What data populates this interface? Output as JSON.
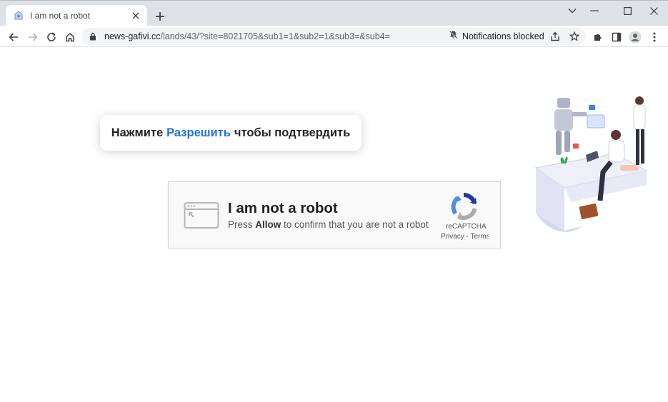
{
  "tab": {
    "title": "I am not a robot"
  },
  "address_bar": {
    "host": "news-gafivi.cc",
    "path": "/lands/43/?site=8021705&sub1=1&sub2=1&sub3=&sub4=",
    "notification_status": "Notifications blocked"
  },
  "bubble": {
    "prefix": "Нажмите",
    "highlight": "Разрешить",
    "suffix": "чтобы подтвердить"
  },
  "captcha": {
    "title": "I am not a robot",
    "sub_prefix": "Press",
    "sub_bold": "Allow",
    "sub_suffix": "to confirm that you are not a robot",
    "brand": "reCAPTCHA",
    "links": "Privacy - Terms"
  },
  "colors": {
    "accent": "#1a73e8",
    "titlebar": "#dee1e6",
    "omnibox": "#f1f3f4"
  },
  "icons": [
    "tab-favicon-icon",
    "close-icon",
    "plus-icon",
    "minimize-icon",
    "maximize-icon",
    "window-close-icon",
    "back-arrow-icon",
    "forward-arrow-icon",
    "reload-icon",
    "home-icon",
    "lock-icon",
    "bell-off-icon",
    "share-icon",
    "star-icon",
    "puzzle-icon",
    "side-panel-icon",
    "profile-icon",
    "kebab-menu-icon",
    "browser-window-icon",
    "recaptcha-logo-icon"
  ]
}
